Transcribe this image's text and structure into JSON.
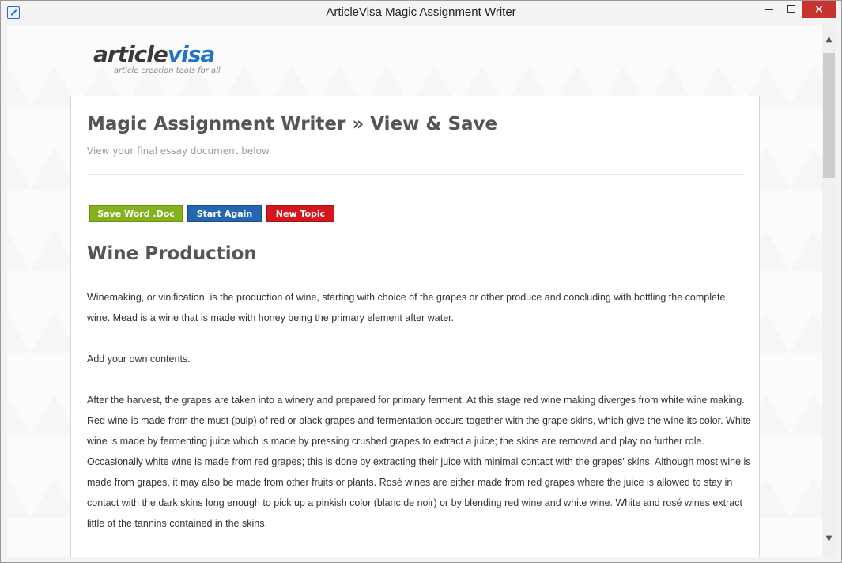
{
  "window": {
    "title": "ArticleVisa Magic Assignment Writer",
    "controls": {
      "minimize": "minimize",
      "maximize": "maximize",
      "close": "✕"
    }
  },
  "logo": {
    "part1": "article",
    "part2": "visa",
    "tagline": "article creation tools for all"
  },
  "page": {
    "title": "Magic Assignment Writer » View & Save",
    "subtitle": "View your final essay document below."
  },
  "buttons": {
    "save": "Save Word .Doc",
    "start_again": "Start Again",
    "new_topic": "New Topic"
  },
  "essay": {
    "title": "Wine Production",
    "paragraphs": [
      "Winemaking, or vinification, is the production of wine, starting with choice of the grapes or other produce and concluding with bottling the complete wine. Mead is a wine that is made with honey being the primary element after water.",
      "Add your own contents.",
      "After the harvest, the grapes are taken into a winery and prepared for primary ferment. At this stage red wine making diverges from white wine making. Red wine is made from the must (pulp) of red or black grapes and fermentation occurs together with the grape skins, which give the wine its color. White wine is made by fermenting juice which is made by pressing crushed grapes to extract a juice; the skins are removed and play no further role. Occasionally white wine is made from red grapes; this is done by extracting their juice with minimal contact with the grapes' skins. Although most wine is made from grapes, it may also be made from other fruits or plants. Rosé wines are either made from red grapes where the juice is allowed to stay in contact with the dark skins long enough to pick up a pinkish color (blanc de noir) or by blending red wine and white wine. White and rosé wines extract little of the tannins contained in the skins."
    ]
  },
  "colors": {
    "save_button": "#84b21c",
    "start_again_button": "#2467b0",
    "new_topic_button": "#d4161e",
    "logo_accent": "#1f74c9",
    "close_button": "#c7332e"
  }
}
